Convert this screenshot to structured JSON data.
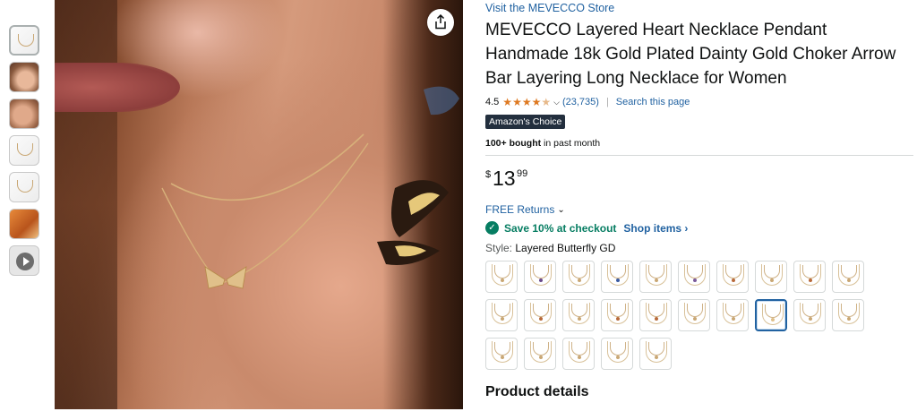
{
  "thumbnails": [
    {
      "name": "thumb-1",
      "kind": "white"
    },
    {
      "name": "thumb-2",
      "kind": "skin"
    },
    {
      "name": "thumb-3",
      "kind": "skin2"
    },
    {
      "name": "thumb-4",
      "kind": "white"
    },
    {
      "name": "thumb-5",
      "kind": "white"
    },
    {
      "name": "thumb-6",
      "kind": "orange"
    },
    {
      "name": "thumb-7",
      "kind": "video"
    }
  ],
  "product": {
    "store_link": "Visit the MEVECCO Store",
    "title": "MEVECCO Layered Heart Necklace Pendant Handmade 18k Gold Plated Dainty Gold Choker Arrow Bar Layering Long Necklace for Women",
    "rating_value": "4.5",
    "star_fill": 0.85,
    "rating_count": "(23,735)",
    "rating_separator": "|",
    "search_page": "Search this page",
    "badge": "Amazon's Choice",
    "bought_bold": "100+ bought",
    "bought_rest": " in past month",
    "price_symbol": "$",
    "price_whole": "13",
    "price_fraction": "99",
    "returns": "FREE Returns",
    "save_text": "Save 10% at checkout",
    "shop_items": "Shop items",
    "style_label": "Style:",
    "style_value": "Layered Butterfly GD",
    "swatch_count": 25,
    "selected_swatch_index": 17,
    "section_heading": "Product details"
  },
  "colors": {
    "link": "#2162a1",
    "star": "#de7921",
    "badge_bg": "#232f3e",
    "save_green": "#067d62",
    "selected_border": "#2162a1"
  },
  "icons": {
    "share": "share-icon",
    "check": "check-circle-icon",
    "chevron": "chevron-down-icon",
    "play": "play-icon"
  }
}
